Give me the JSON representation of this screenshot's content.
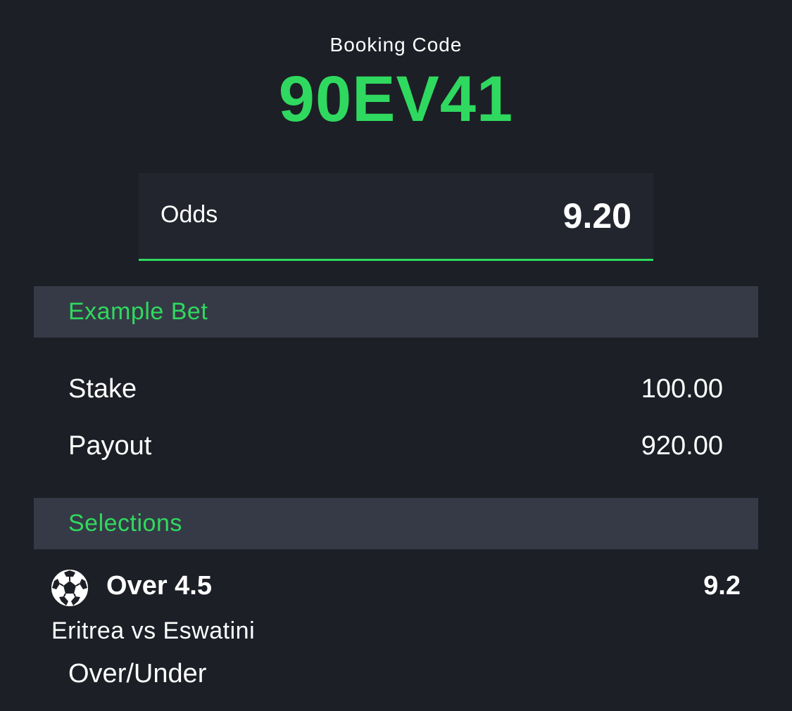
{
  "header": {
    "label": "Booking Code",
    "code": "90EV41"
  },
  "odds": {
    "label": "Odds",
    "value": "9.20"
  },
  "example_bet": {
    "title": "Example Bet",
    "stake_label": "Stake",
    "stake_value": "100.00",
    "payout_label": "Payout",
    "payout_value": "920.00"
  },
  "selections": {
    "title": "Selections",
    "items": [
      {
        "icon": "soccer-ball-icon",
        "pick": "Over 4.5",
        "odds": "9.2",
        "match": "Eritrea vs Eswatini",
        "market": "Over/Under"
      }
    ]
  },
  "colors": {
    "background": "#1c1f26",
    "accent": "#2fd95f",
    "panel": "#22252e",
    "section_bar": "#363a46",
    "text": "#ffffff"
  }
}
